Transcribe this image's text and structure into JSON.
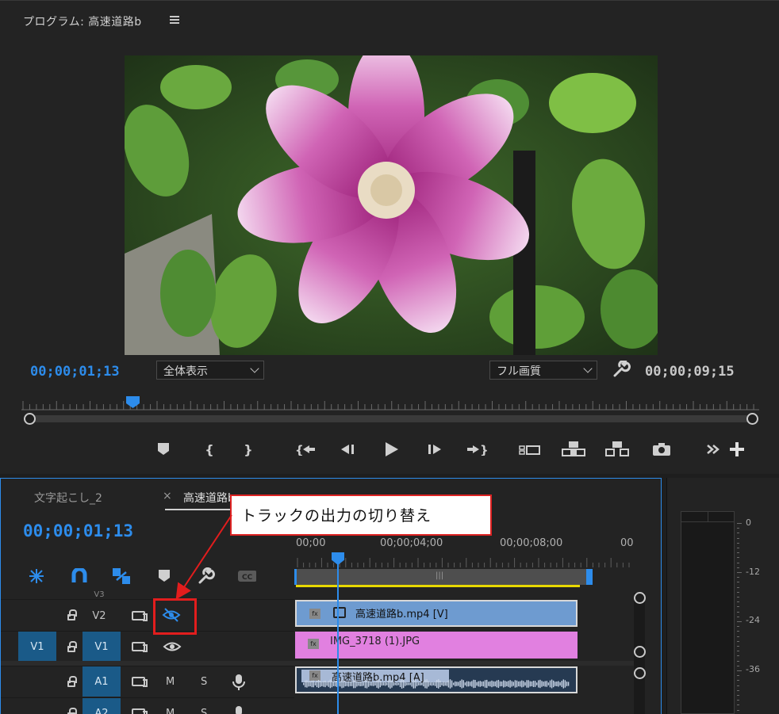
{
  "program": {
    "title": "プログラム: 高速道路b",
    "current_timecode": "00;00;01;13",
    "duration_timecode": "00;00;09;15",
    "zoom_select": "全体表示",
    "quality_select": "フル画質"
  },
  "timeline": {
    "tabs": [
      {
        "label": "文字起こし_2"
      },
      {
        "label": "高速道路b"
      }
    ],
    "close_glyph": "×",
    "timecode": "00;00;01;13",
    "ruler": [
      "00;00",
      "00;00;04;00",
      "00;00;08;00",
      "00"
    ],
    "tracks": [
      {
        "label": "V3"
      },
      {
        "label": "V2"
      },
      {
        "label": "V1",
        "source": "V1"
      },
      {
        "label": "A1"
      },
      {
        "label": "A2"
      }
    ],
    "clips": [
      {
        "name": "高速道路b.mp4 [V]",
        "color": "#6e9bd0"
      },
      {
        "name": "IMG_3718 (1).JPG",
        "color": "#e180e0"
      },
      {
        "name": "高速道路b.mp4 [A]",
        "color": "#a7b9d6"
      }
    ],
    "mute_label": "M",
    "solo_label": "S",
    "fx_label": "fx"
  },
  "callout": {
    "text": "トラックの出力の切り替え"
  },
  "meter": {
    "scale": [
      "0",
      "-12",
      "-24",
      "-36"
    ]
  },
  "colors": {
    "accent": "#2d8ceb",
    "callout_border": "#dd2222",
    "yellow_bar": "#e8d800"
  }
}
